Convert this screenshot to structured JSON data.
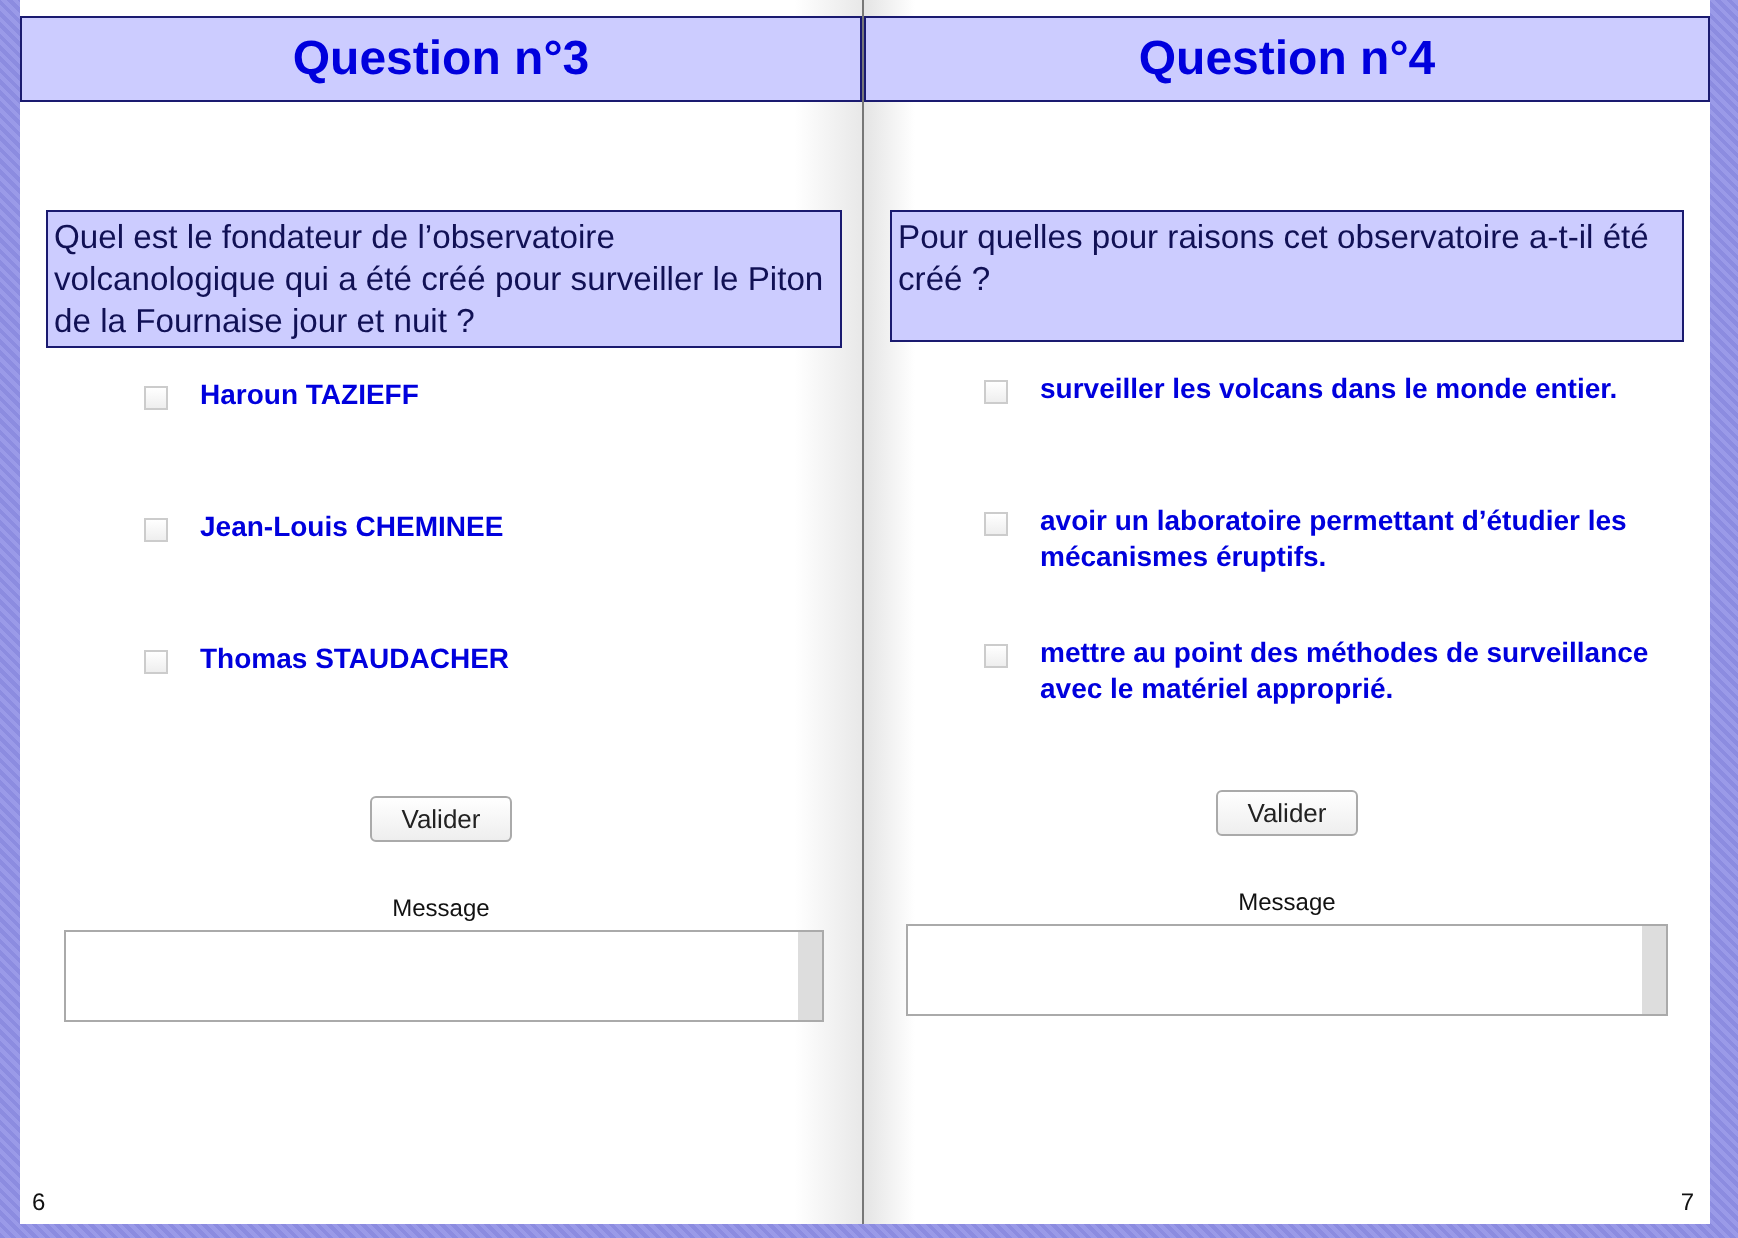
{
  "pages": [
    {
      "title": "Question n°3",
      "question": "Quel est le fondateur de l’observatoire volcanologique qui a été créé pour surveiller le Piton de la Fournaise jour et nuit ?",
      "options": [
        {
          "label": "Haroun TAZIEFF",
          "checked": false
        },
        {
          "label": "Jean-Louis CHEMINEE",
          "checked": false
        },
        {
          "label": "Thomas STAUDACHER",
          "checked": false
        }
      ],
      "button": "Valider",
      "message_label": "Message",
      "page_number": "6"
    },
    {
      "title": "Question n°4",
      "question": "Pour quelles pour raisons cet observatoire a-t-il été créé ?",
      "options": [
        {
          "label": "surveiller les volcans dans le monde entier.",
          "checked": false
        },
        {
          "label": "avoir un laboratoire permettant d’étudier les mécanismes éruptifs.",
          "checked": false
        },
        {
          "label": "mettre au point des méthodes de surveillance avec le matériel approprié.",
          "checked": false
        }
      ],
      "button": "Valider",
      "message_label": "Message",
      "page_number": "7"
    }
  ]
}
